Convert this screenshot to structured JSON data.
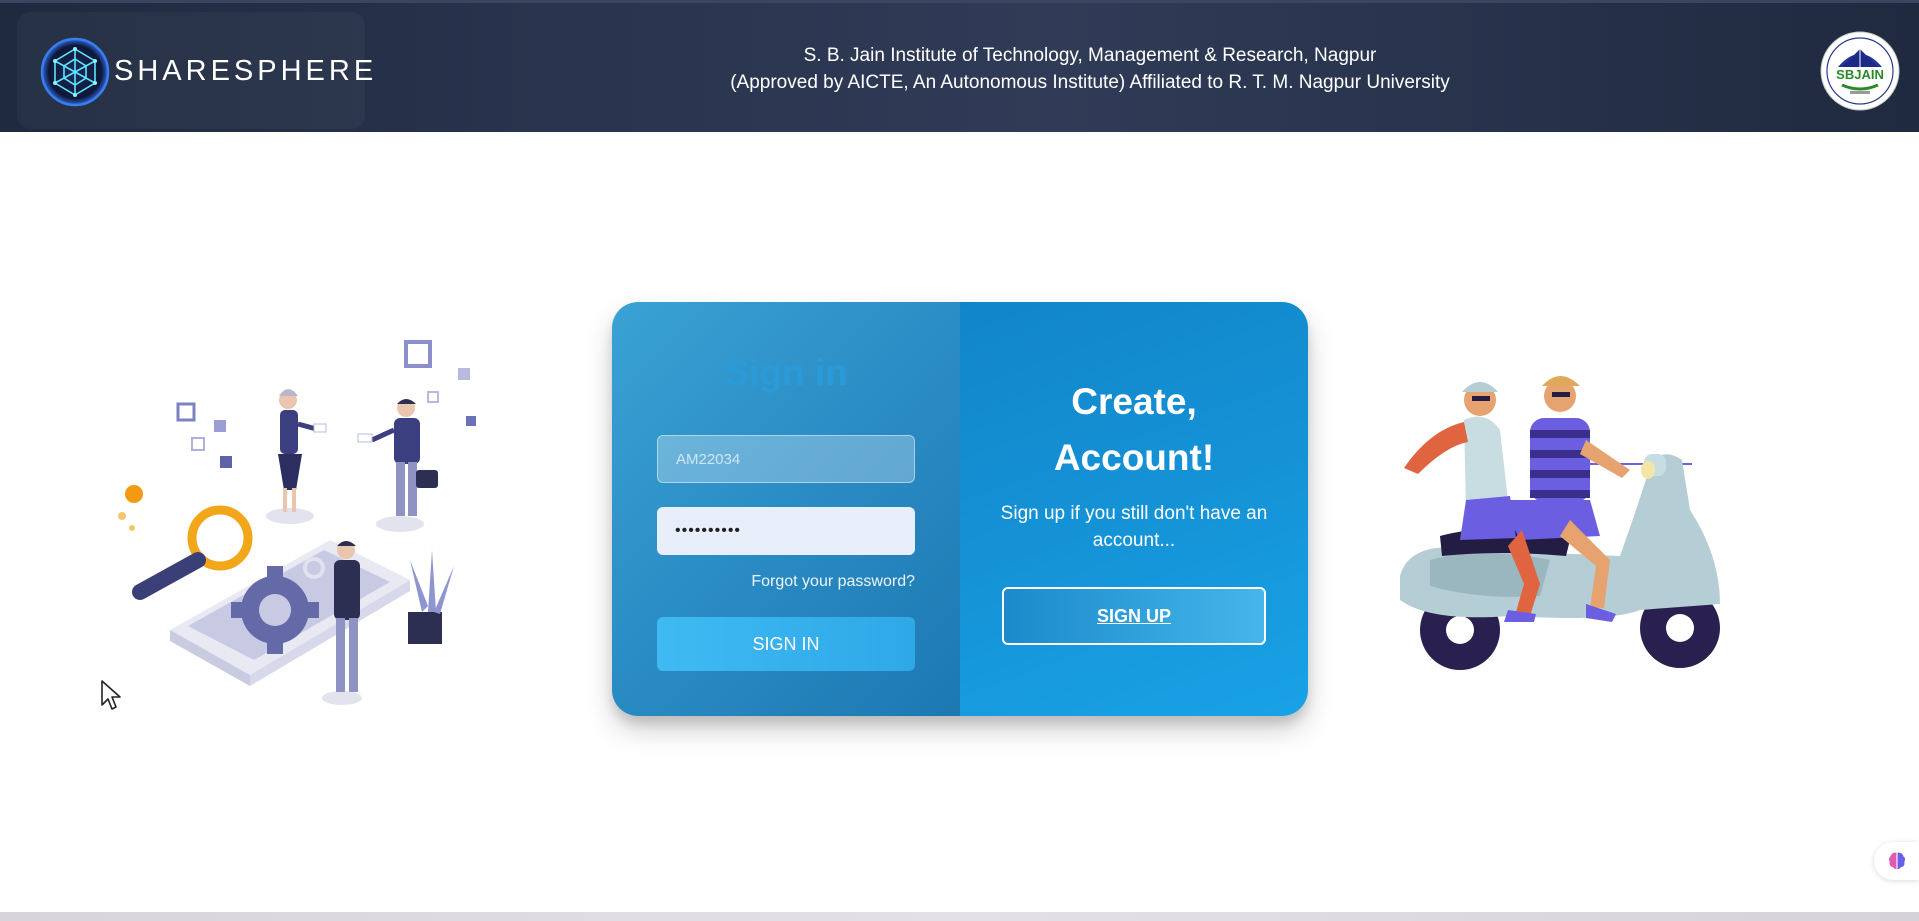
{
  "header": {
    "brand_name": "SHARESPHERE",
    "institute_line1": "S. B. Jain Institute of Technology, Management & Research, Nagpur",
    "institute_line2": "(Approved by AICTE, An Autonomous Institute) Affiliated to R. T. M. Nagpur University",
    "institute_logo_text": "SBJAIN",
    "icons": {
      "brand": "sharesphere-logo-icon",
      "institute": "sbjain-logo-icon"
    }
  },
  "signin": {
    "title": "Sign in",
    "username_value": "AM22034",
    "password_value": "••••••••••",
    "forgot_label": "Forgot your password?",
    "button_label": "SIGN IN"
  },
  "signup": {
    "title": "Create, Account!",
    "subtitle": "Sign up if you still don't have an account...",
    "button_label": "SIGN UP"
  },
  "colors": {
    "header_bg": "#26324a",
    "panel_left": "#2a8cc4",
    "panel_right": "#1592d6",
    "accent": "#3fbaf2"
  },
  "icons": {
    "left_illustration": "team-collaboration-illustration",
    "right_illustration": "scooter-riders-illustration",
    "assistant": "brain-icon",
    "cursor": "mouse-pointer-icon"
  }
}
